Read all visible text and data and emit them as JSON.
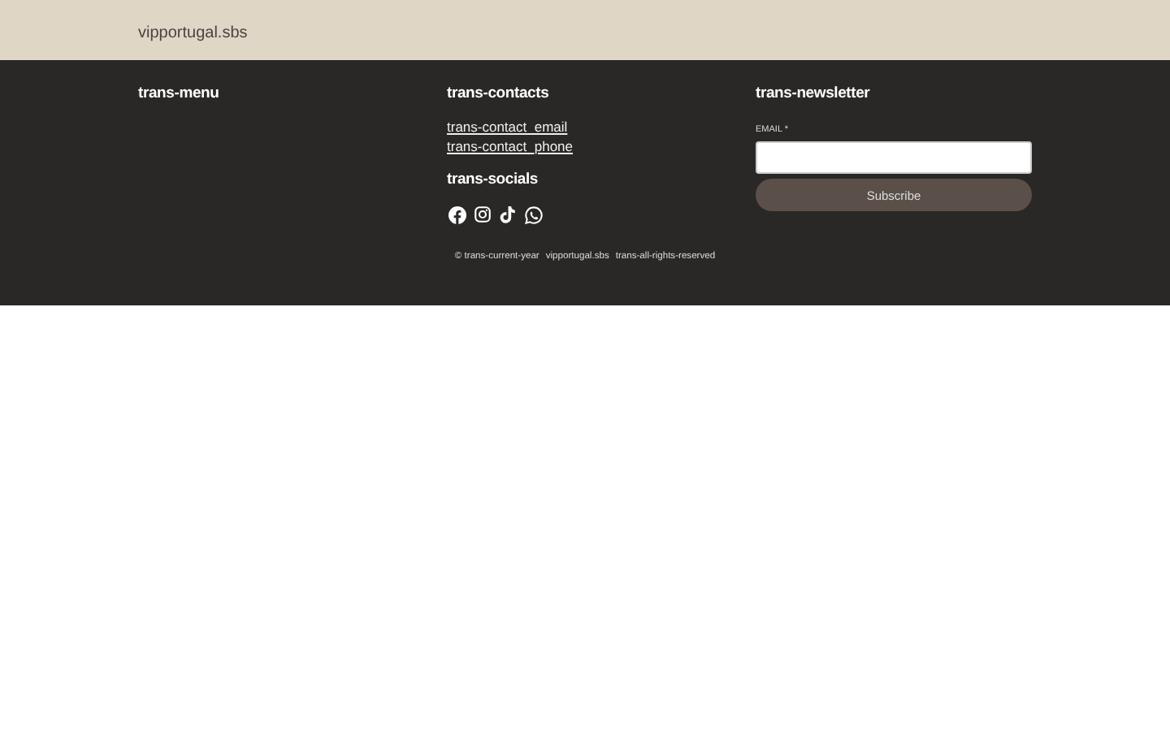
{
  "header": {
    "site_name": "vipportugal.sbs"
  },
  "footer": {
    "menu": {
      "title": "trans-menu"
    },
    "contacts": {
      "title": "trans-contacts",
      "links": [
        "trans-contact_email",
        "trans-contact_phone"
      ]
    },
    "socials": {
      "title": "trans-socials",
      "items": [
        {
          "kind": "facebook"
        },
        {
          "kind": "instagram"
        },
        {
          "kind": "tiktok"
        },
        {
          "kind": "whatsapp"
        }
      ]
    },
    "newsletter": {
      "title": "trans-newsletter",
      "email_label": "EMAIL *",
      "button": "Subscribe"
    },
    "copyright": [
      "© trans-current-year",
      "vipportugal.sbs",
      "trans-all-rights-reserved"
    ]
  }
}
